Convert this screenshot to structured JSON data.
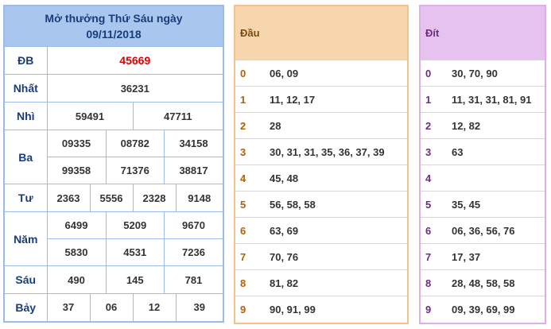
{
  "results": {
    "title": "Mở thưởng Thứ Sáu ngày",
    "date": "09/11/2018",
    "rows": [
      {
        "label": "ĐB",
        "values": [
          "45669"
        ]
      },
      {
        "label": "Nhất",
        "values": [
          "36231"
        ]
      },
      {
        "label": "Nhì",
        "values": [
          "59491",
          "47711"
        ]
      },
      {
        "label": "Ba",
        "values": [
          "09335",
          "08782",
          "34158",
          "99358",
          "71376",
          "38817"
        ]
      },
      {
        "label": "Tư",
        "values": [
          "2363",
          "5556",
          "2328",
          "9148"
        ]
      },
      {
        "label": "Năm",
        "values": [
          "6499",
          "5209",
          "9670",
          "5830",
          "4531",
          "7236"
        ]
      },
      {
        "label": "Sáu",
        "values": [
          "490",
          "145",
          "781"
        ]
      },
      {
        "label": "Bảy",
        "values": [
          "37",
          "06",
          "12",
          "39"
        ]
      }
    ]
  },
  "dau": {
    "header": "Đầu",
    "rows": [
      {
        "key": "0",
        "values": "06, 09"
      },
      {
        "key": "1",
        "values": "11, 12, 17"
      },
      {
        "key": "2",
        "values": "28"
      },
      {
        "key": "3",
        "values": "30, 31, 31, 35, 36, 37, 39"
      },
      {
        "key": "4",
        "values": "45, 48"
      },
      {
        "key": "5",
        "values": "56, 58, 58"
      },
      {
        "key": "6",
        "values": "63, 69"
      },
      {
        "key": "7",
        "values": "70, 76"
      },
      {
        "key": "8",
        "values": "81, 82"
      },
      {
        "key": "9",
        "values": "90, 91, 99"
      }
    ]
  },
  "dit": {
    "header": "Đít",
    "rows": [
      {
        "key": "0",
        "values": "30, 70, 90"
      },
      {
        "key": "1",
        "values": "11, 31, 31, 81, 91"
      },
      {
        "key": "2",
        "values": "12, 82"
      },
      {
        "key": "3",
        "values": "63"
      },
      {
        "key": "4",
        "values": ""
      },
      {
        "key": "5",
        "values": "35, 45"
      },
      {
        "key": "6",
        "values": "06, 36, 56, 76"
      },
      {
        "key": "7",
        "values": "17, 37"
      },
      {
        "key": "8",
        "values": "28, 48, 58, 58"
      },
      {
        "key": "9",
        "values": "09, 39, 69, 99"
      }
    ]
  }
}
